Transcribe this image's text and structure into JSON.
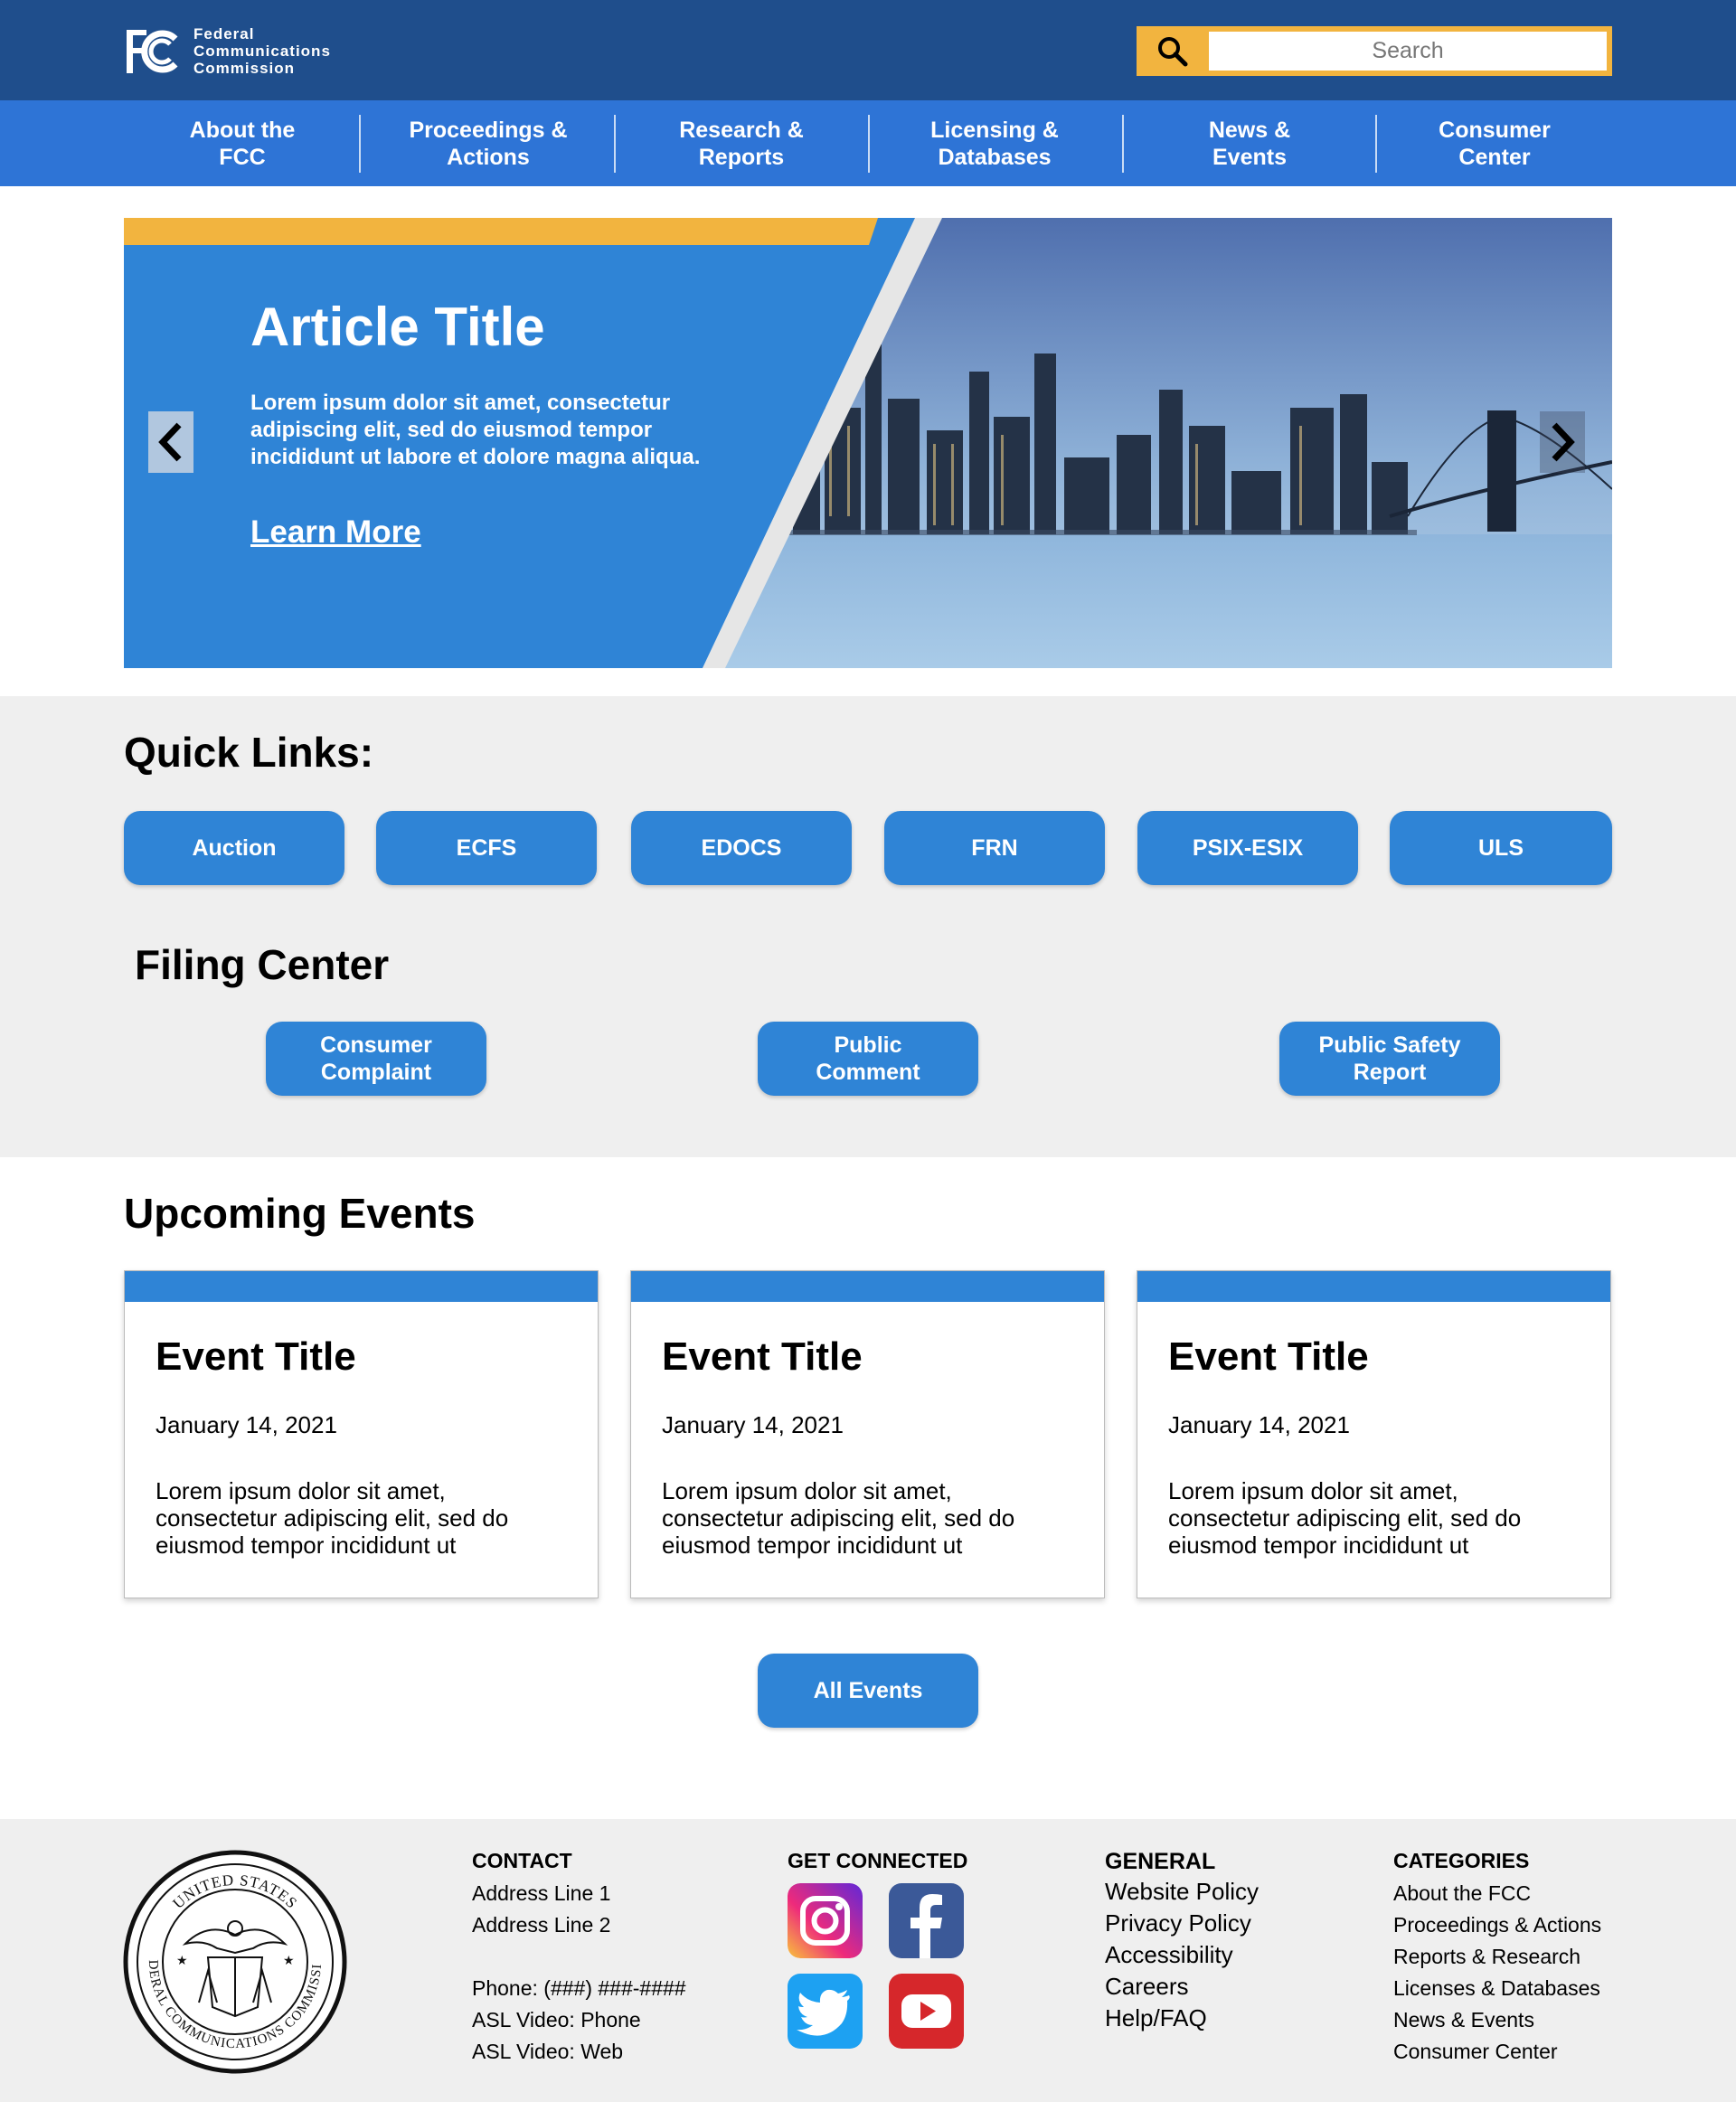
{
  "header": {
    "logo_lines": [
      "Federal",
      "Communications",
      "Commission"
    ],
    "search_placeholder": "Search"
  },
  "nav": {
    "items": [
      {
        "label": "About the\nFCC"
      },
      {
        "label": "Proceedings &\nActions"
      },
      {
        "label": "Research &\nReports"
      },
      {
        "label": "Licensing &\nDatabases"
      },
      {
        "label": "News &\nEvents"
      },
      {
        "label": "Consumer\nCenter"
      }
    ]
  },
  "hero": {
    "title": "Article Title",
    "text": "Lorem ipsum dolor sit amet, consectetur adipiscing elit, sed do eiusmod tempor incididunt ut labore et dolore magna aliqua.",
    "link": "Learn More"
  },
  "quick_links": {
    "heading": "Quick Links:",
    "items": [
      "Auction",
      "ECFS",
      "EDOCS",
      "FRN",
      "PSIX-ESIX",
      "ULS"
    ]
  },
  "filing_center": {
    "heading": "Filing Center",
    "items": [
      "Consumer\nComplaint",
      "Public\nComment",
      "Public Safety\nReport"
    ]
  },
  "events": {
    "heading": "Upcoming Events",
    "items": [
      {
        "title": "Event Title",
        "date": "January 14, 2021",
        "desc": "Lorem ipsum dolor sit amet, consectetur adipiscing elit, sed do eiusmod tempor incididunt ut"
      },
      {
        "title": "Event Title",
        "date": "January 14, 2021",
        "desc": "Lorem ipsum dolor sit amet, consectetur adipiscing elit, sed do eiusmod tempor incididunt ut"
      },
      {
        "title": "Event Title",
        "date": "January 14, 2021",
        "desc": "Lorem ipsum dolor sit amet, consectetur adipiscing elit, sed do eiusmod tempor incididunt ut"
      }
    ],
    "all_button": "All Events"
  },
  "footer": {
    "seal_text_top": "UNITED STATES",
    "seal_text_bottom": "FEDERAL COMMUNICATIONS COMMISSION",
    "contact": {
      "heading": "CONTACT",
      "lines": [
        "Address Line 1",
        "Address Line 2",
        "",
        "Phone: (###) ###-####",
        "ASL Video: Phone",
        "ASL Video: Web"
      ]
    },
    "connected": {
      "heading": "GET CONNECTED",
      "icons": [
        "instagram-icon",
        "facebook-icon",
        "twitter-icon",
        "youtube-icon"
      ]
    },
    "general": {
      "heading": "GENERAL",
      "links": [
        "Website Policy",
        "Privacy Policy",
        "Accessibility",
        "Careers",
        "Help/FAQ"
      ]
    },
    "categories": {
      "heading": "CATEGORIES",
      "links": [
        "About the FCC",
        "Proceedings & Actions",
        "Reports & Research",
        "Licenses & Databases",
        "News & Events",
        "Consumer Center"
      ]
    }
  },
  "colors": {
    "header_dark": "#1f4e8c",
    "nav_blue": "#2e74d6",
    "accent_blue": "#2f84d6",
    "accent_gold": "#f2b43f",
    "section_grey": "#efefef"
  }
}
